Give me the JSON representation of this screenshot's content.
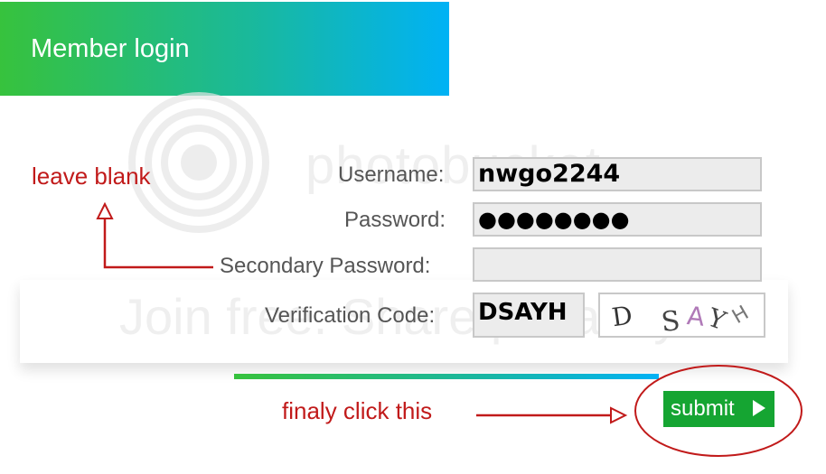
{
  "header": {
    "title": "Member login"
  },
  "watermark": {
    "line1": "photobucket",
    "line2": "Join free. Share privately."
  },
  "form": {
    "username_label": "Username:",
    "username_value": "nwgo2244",
    "password_label": "Password:",
    "password_value": "●●●●●●●●",
    "secondary_password_label": "Secondary Password:",
    "secondary_password_value": "",
    "verification_label": "Verification Code:",
    "verification_value": "DSAYH",
    "captcha_text": "D SAY H"
  },
  "submit": {
    "label": "submit"
  },
  "annotations": {
    "leave_blank": "leave blank",
    "final_click": "finaly click this",
    "color": "#c11a1a"
  },
  "colors": {
    "header_start": "#37c23d",
    "header_end": "#00b2f5",
    "submit_bg": "#15a532"
  }
}
